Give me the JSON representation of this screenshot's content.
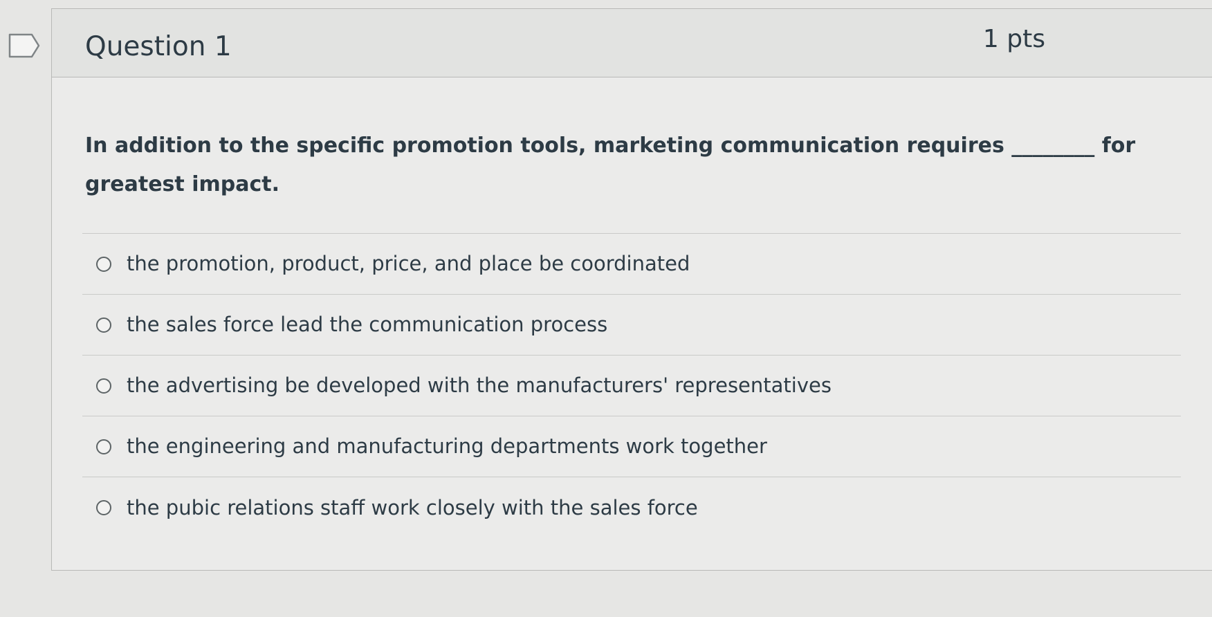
{
  "question": {
    "title": "Question 1",
    "points": "1 pts",
    "text": "In addition to the specific promotion tools, marketing communication requires ________ for greatest impact."
  },
  "answers": [
    {
      "label": "the promotion, product, price, and place be coordinated"
    },
    {
      "label": "the sales force lead the communication process"
    },
    {
      "label": "the advertising be developed with the manufacturers' representatives"
    },
    {
      "label": "the engineering and manufacturing departments work together"
    },
    {
      "label": "the pubic relations staff work closely with the sales force"
    }
  ],
  "icons": {
    "bookmark": "bookmark-flag-icon",
    "radio": "radio-unselected-icon"
  },
  "colors": {
    "text": "#2d3b45",
    "background": "#e6e6e4",
    "card_header": "#e2e3e1",
    "card_body": "#ebebea",
    "border": "#b8b9b7"
  }
}
